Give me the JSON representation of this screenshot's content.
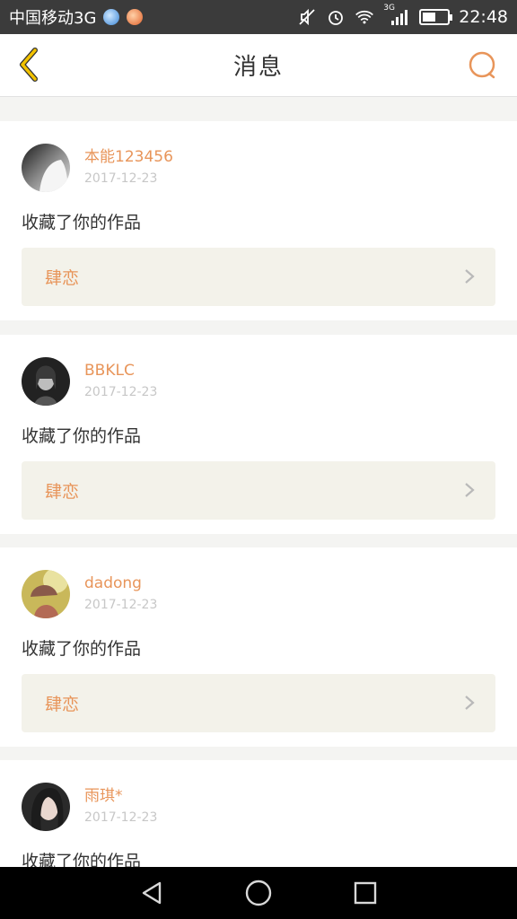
{
  "status_bar": {
    "carrier": "中国移动3G",
    "network_badge": "3G",
    "time": "22:48",
    "battery_level": 0.55,
    "icons": [
      "app-blue-icon",
      "app-orange-icon",
      "mute-icon",
      "alarm-icon",
      "wifi-icon",
      "signal-icon",
      "battery-icon"
    ]
  },
  "nav": {
    "title": "消息",
    "back_icon": "chevron-left-icon",
    "search_icon": "search-icon",
    "accent_color": "#e8955a",
    "back_color": "#e6b800"
  },
  "messages": [
    {
      "username": "本能123456",
      "date": "2017-12-23",
      "action": "收藏了你的作品",
      "item_title": "肆恋",
      "avatar": "avatar-gray"
    },
    {
      "username": "BBKLC",
      "date": "2017-12-23",
      "action": "收藏了你的作品",
      "item_title": "肆恋",
      "avatar": "avatar-dark"
    },
    {
      "username": "dadong",
      "date": "2017-12-23",
      "action": "收藏了你的作品",
      "item_title": "肆恋",
      "avatar": "avatar-warm"
    },
    {
      "username": "雨琪*",
      "date": "2017-12-23",
      "action": "收藏了你的作品",
      "item_title": "",
      "avatar": "avatar-portrait"
    }
  ],
  "system_nav": {
    "icons": [
      "back-triangle-icon",
      "home-circle-icon",
      "recents-square-icon"
    ]
  }
}
